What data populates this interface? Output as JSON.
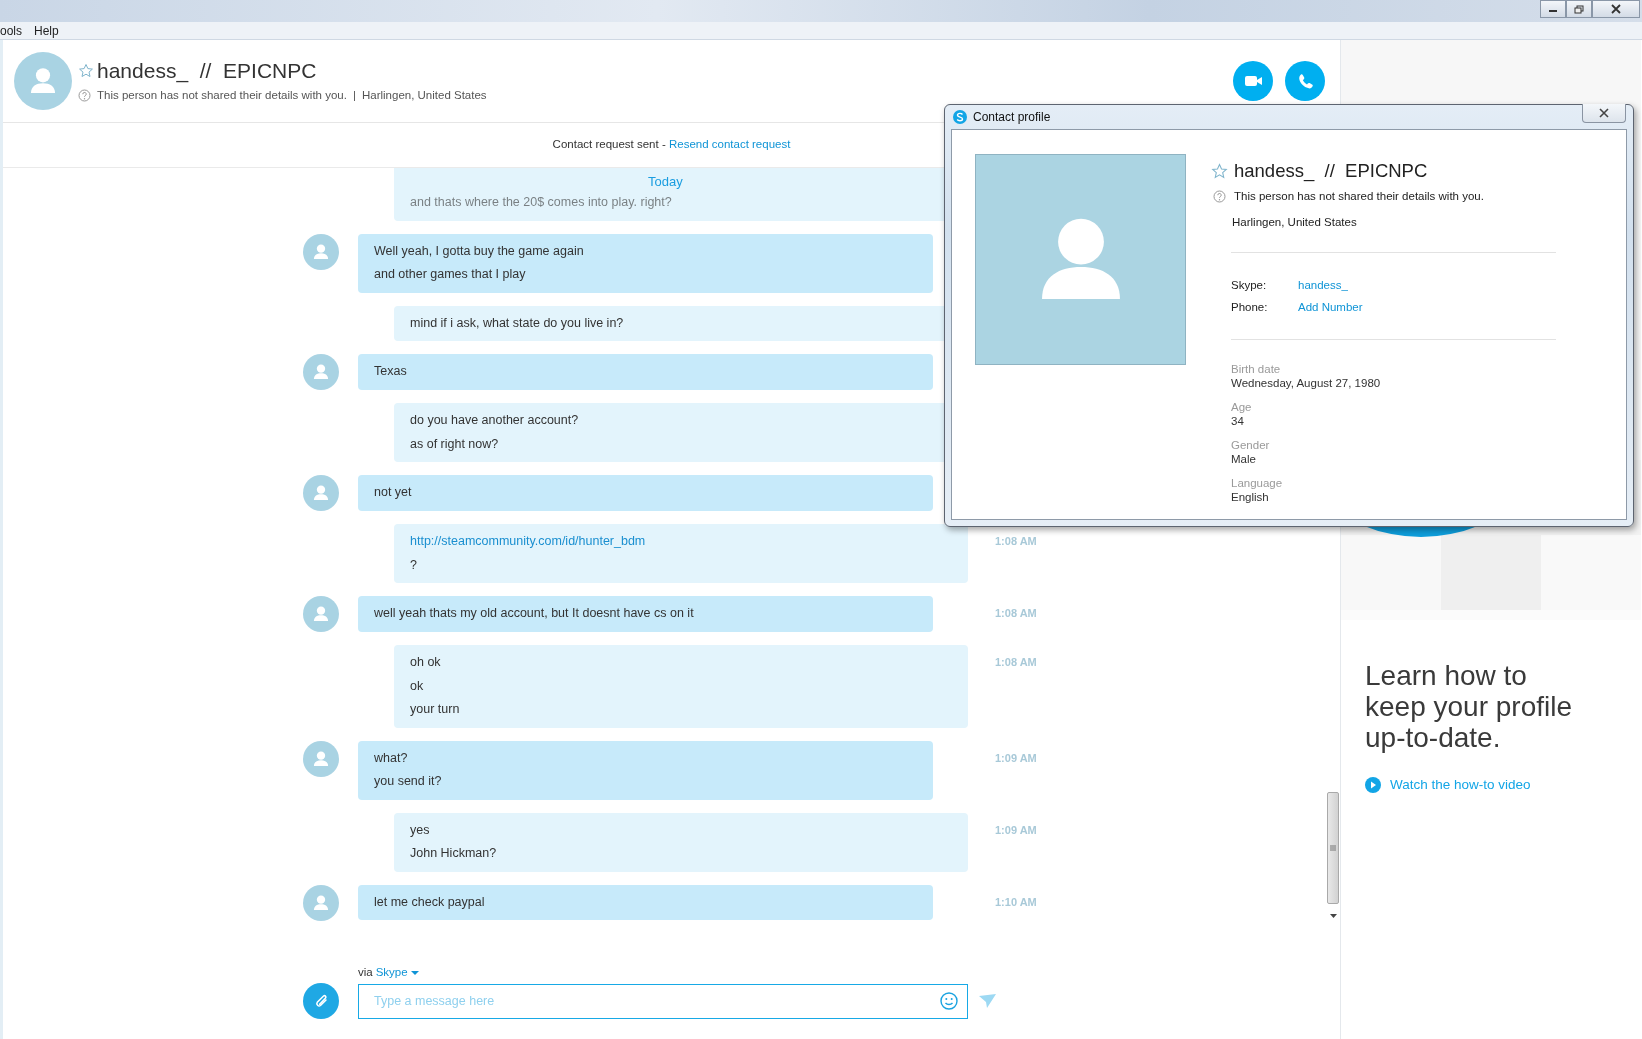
{
  "window": {
    "menu": [
      "ools",
      "Help"
    ]
  },
  "contact": {
    "name": "handess_  //  EPICNPC",
    "favorite": false,
    "notice": "This person has not shared their details with you.",
    "separator": "|",
    "location": "Harlingen, United States"
  },
  "request_bar": {
    "text": "Contact request sent - ",
    "link": "Resend contact request"
  },
  "date_divider": "Today",
  "messages": [
    {
      "kind": "outgoing",
      "faded": true,
      "lines": [
        {
          "text": "and thats where the 20$ comes into play. right?",
          "link": false
        }
      ]
    },
    {
      "kind": "incoming",
      "faded": false,
      "lines": [
        {
          "text": "Well yeah, I gotta buy the game again",
          "link": false
        },
        {
          "text": "and other games that I play",
          "link": false
        }
      ]
    },
    {
      "kind": "outgoing",
      "faded": false,
      "lines": [
        {
          "text": "mind if i ask, what state do you live in?",
          "link": false
        }
      ]
    },
    {
      "kind": "incoming",
      "faded": false,
      "lines": [
        {
          "text": "Texas",
          "link": false
        }
      ]
    },
    {
      "kind": "outgoing",
      "faded": false,
      "lines": [
        {
          "text": "do you have another account?",
          "link": false
        },
        {
          "text": "as of right now?",
          "link": false
        }
      ]
    },
    {
      "kind": "incoming",
      "faded": false,
      "lines": [
        {
          "text": "not yet",
          "link": false
        }
      ]
    },
    {
      "kind": "outgoing",
      "faded": false,
      "time": "1:08 AM",
      "lines": [
        {
          "text": "http://steamcommunity.com/id/hunter_bdm",
          "link": true
        },
        {
          "text": "?",
          "link": false
        }
      ]
    },
    {
      "kind": "incoming",
      "faded": false,
      "time": "1:08 AM",
      "lines": [
        {
          "text": "well yeah thats my old account, but It doesnt have cs on it",
          "link": false
        }
      ]
    },
    {
      "kind": "outgoing",
      "faded": false,
      "time": "1:08 AM",
      "lines": [
        {
          "text": "oh ok",
          "link": false
        },
        {
          "text": "ok",
          "link": false
        },
        {
          "text": "your turn",
          "link": false
        }
      ]
    },
    {
      "kind": "incoming",
      "faded": false,
      "time": "1:09 AM",
      "lines": [
        {
          "text": "what?",
          "link": false
        },
        {
          "text": "you send it?",
          "link": false
        }
      ]
    },
    {
      "kind": "outgoing",
      "faded": false,
      "time": "1:09 AM",
      "lines": [
        {
          "text": "yes",
          "link": false
        },
        {
          "text": "John Hickman?",
          "link": false
        }
      ]
    },
    {
      "kind": "incoming",
      "faded": false,
      "time": "1:10 AM",
      "lines": [
        {
          "text": "let me check paypal",
          "link": false
        }
      ]
    }
  ],
  "composer": {
    "via": "via",
    "service": "Skype",
    "placeholder": "Type a message here"
  },
  "profile_dialog": {
    "title": "Contact profile",
    "name": "handess_  //  EPICNPC",
    "favorite": false,
    "notice": "This person has not shared their details with you.",
    "location": "Harlingen, United States",
    "fields": [
      {
        "label": "Skype:",
        "value": "handess_"
      },
      {
        "label": "Phone:",
        "value": "Add Number"
      }
    ],
    "details": [
      {
        "label": "Birth date",
        "value": "Wednesday, August 27, 1980"
      },
      {
        "label": "Age",
        "value": "34"
      },
      {
        "label": "Gender",
        "value": "Male"
      },
      {
        "label": "Language",
        "value": "English"
      }
    ]
  },
  "promo": {
    "heading": "Learn how to keep your profile up-to-date.",
    "link": "Watch the how-to video"
  }
}
